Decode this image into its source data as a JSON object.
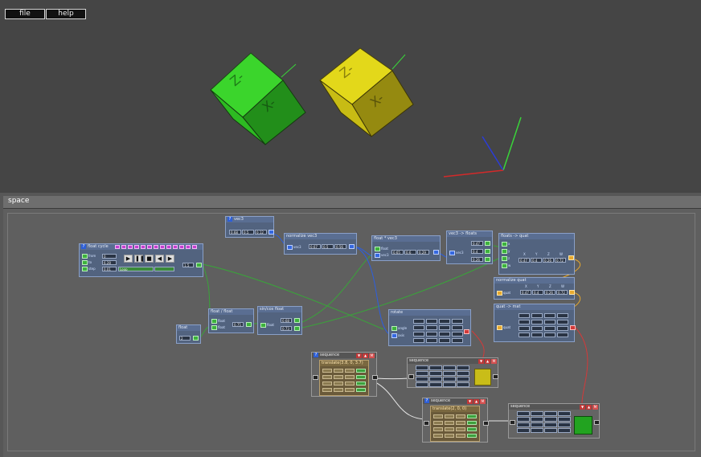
{
  "menu": {
    "file": "file",
    "help": "help"
  },
  "panel": {
    "title": "space"
  },
  "nodes": {
    "vec3": {
      "title": "vec3",
      "values": [
        "0.68",
        "0.5",
        "0.12"
      ]
    },
    "normalize": {
      "title": "normalize vec3",
      "in_label": "vec3",
      "values": [
        "0.67",
        "0.5",
        "0.56"
      ]
    },
    "float_vec3": {
      "title": "float * vec3",
      "in1": "float",
      "in2": "vec3",
      "values": [
        "0.65",
        "0.6",
        "0.29"
      ]
    },
    "vec3_floats": {
      "title": "vec3 -> floats",
      "in_label": "vec3",
      "values": [
        "0.47",
        "0.4",
        "0.26"
      ]
    },
    "floats_quat": {
      "title": "floats -> quat",
      "ins": [
        "x",
        "y",
        "z",
        "w"
      ],
      "headers": [
        "X",
        "Y",
        "Z",
        "W"
      ],
      "values": [
        "0.47",
        "0.4",
        "0.26",
        "0.72"
      ]
    },
    "normalize_quat": {
      "title": "normalize quat",
      "in_label": "quat",
      "headers": [
        "X",
        "Y",
        "Z",
        "W"
      ],
      "values": [
        "0.47",
        "0.4",
        "0.26",
        "0.72"
      ]
    },
    "quat_mat": {
      "title": "quat -> mat",
      "in_label": "quat"
    },
    "float_cycle": {
      "title": "float cycle",
      "in_from": "from",
      "in_to": "to",
      "in_step": "step",
      "from": "0",
      "to": "6.28",
      "step": "0.01",
      "mode": "Loop",
      "out": "1.5"
    },
    "float_div": {
      "title": "float / float",
      "in1": "float",
      "in2": "float",
      "out": "0.75"
    },
    "sincos": {
      "title": "sin/cos float",
      "in_label": "float",
      "out1": "0.68",
      "out2": "0.73"
    },
    "float_small": {
      "title": "float",
      "value": "2"
    },
    "rotate": {
      "title": "rotate",
      "in1": "angle",
      "in2": "axis"
    },
    "seq1": {
      "title": "sequence"
    },
    "seq_yellow": {
      "title": "sequence"
    },
    "seq2": {
      "title": "sequence"
    },
    "seq_green": {
      "title": "sequence"
    },
    "translate1": {
      "title": "translate(3.8, 0, 3.7)"
    },
    "translate2": {
      "title": "translate(2, 0, 0)"
    }
  },
  "colors": {
    "cube_green": "#25a51f",
    "cube_yellow": "#b8ab12",
    "link_green": "#3aa33a",
    "link_blue": "#2c5fe0",
    "link_red": "#d23a3a",
    "link_white": "#e6e6e6"
  }
}
